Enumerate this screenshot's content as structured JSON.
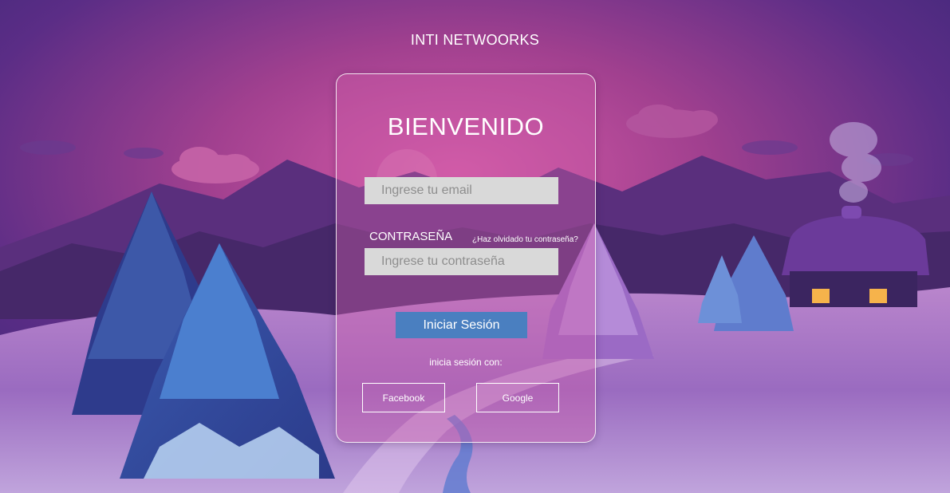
{
  "brand": {
    "name": "INTI NETWOORKS"
  },
  "login": {
    "title": "BIENVENIDO",
    "email_placeholder": "Ingrese tu email",
    "password_label": "CONTRASEÑA",
    "forgot_link": "¿Haz olvidado tu contraseña?",
    "password_placeholder": "Ingrese tu contraseña",
    "submit_label": "Iniciar Sesión",
    "social_prompt": "inicia sesión con:",
    "social": {
      "facebook": "Facebook",
      "google": "Google"
    }
  },
  "colors": {
    "card_fill": "#ce5caa",
    "button_primary": "#4a7fc0",
    "input_fill": "#d9d9d9",
    "sky_top": "#3b2a80",
    "sky_glow": "#c2479a"
  }
}
